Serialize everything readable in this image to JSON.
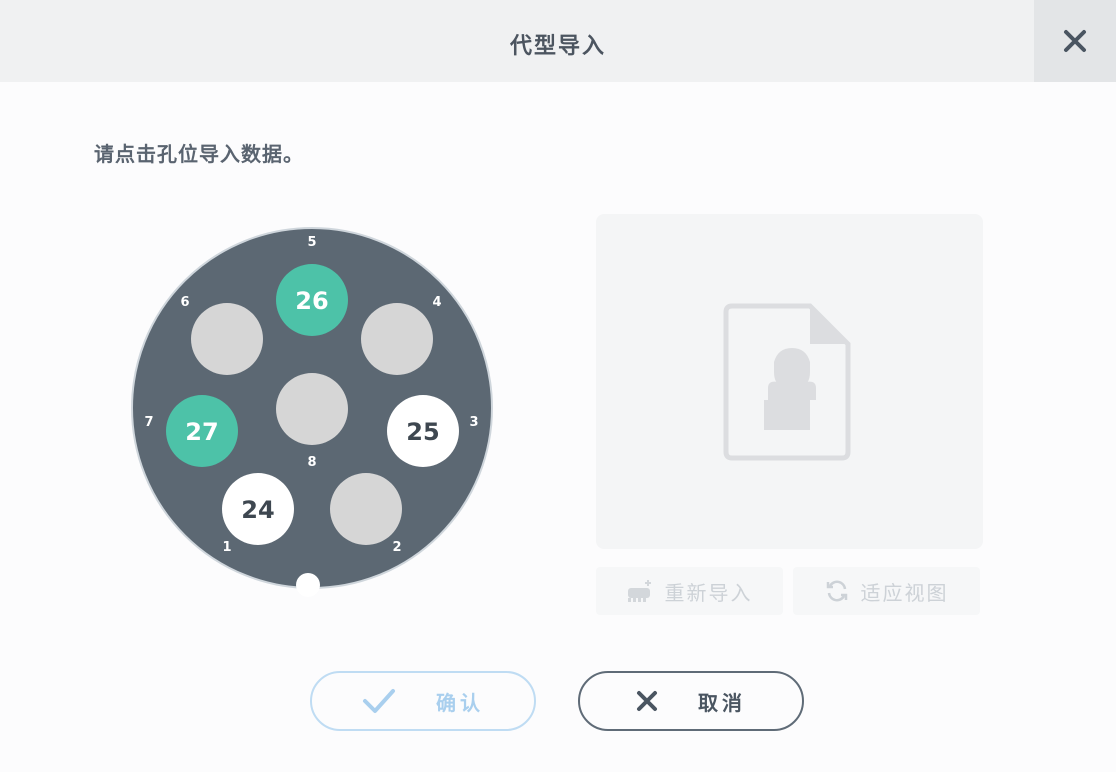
{
  "dialog": {
    "title": "代型导入",
    "close_icon": "close-icon"
  },
  "instruction": "请点击孔位导入数据。",
  "carousel": {
    "slots": [
      {
        "label": "1",
        "value": "24",
        "state": "imported"
      },
      {
        "label": "2",
        "value": "",
        "state": "empty"
      },
      {
        "label": "3",
        "value": "25",
        "state": "imported"
      },
      {
        "label": "4",
        "value": "",
        "state": "empty"
      },
      {
        "label": "5",
        "value": "26",
        "state": "selected"
      },
      {
        "label": "6",
        "value": "",
        "state": "empty"
      },
      {
        "label": "7",
        "value": "27",
        "state": "selected"
      },
      {
        "label": "8",
        "value": "",
        "state": "empty"
      }
    ],
    "colors": {
      "disc": "#5c6873",
      "empty": "#d6d6d6",
      "imported": "#ffffff",
      "selected": "#4dc2a8"
    }
  },
  "preview": {
    "placeholder_icon": "tooth-file-icon"
  },
  "toolbar": {
    "reimport_label": "重新导入",
    "reimport_icon": "reimport-icon",
    "fit_view_label": "适应视图",
    "fit_view_icon": "refresh-icon"
  },
  "actions": {
    "confirm_label": "确认",
    "confirm_icon": "check-icon",
    "cancel_label": "取消",
    "cancel_icon": "close-icon"
  }
}
